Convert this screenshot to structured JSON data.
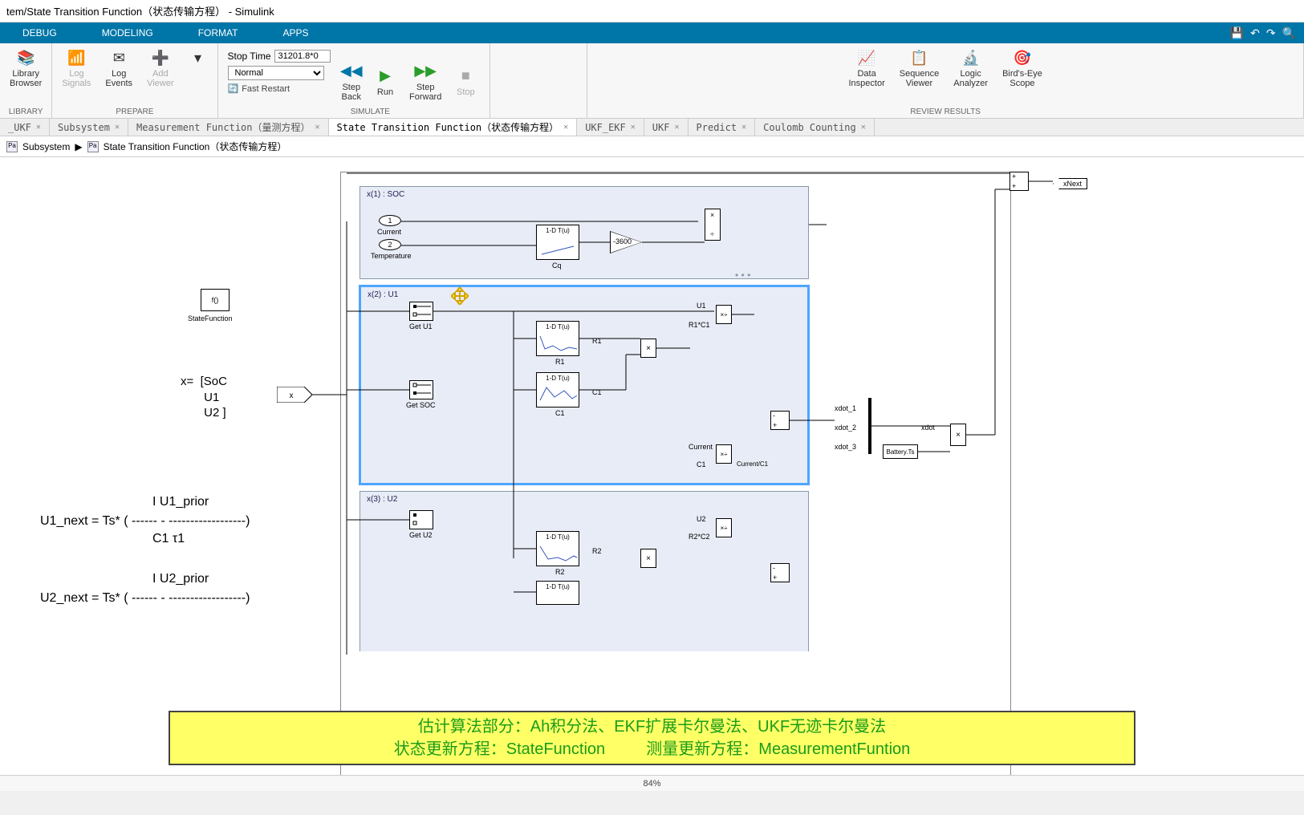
{
  "titlebar": "tem/State Transition Function（状态传输方程） - Simulink",
  "ribbon": {
    "tabs": [
      "DEBUG",
      "MODELING",
      "FORMAT",
      "APPS"
    ],
    "save_icon": "💾",
    "undo_icon": "↶",
    "redo_icon": "↷",
    "search_icon": "🔍"
  },
  "toolstrip": {
    "library": {
      "label": "Library\nBrowser",
      "group": "LIBRARY"
    },
    "prepare": {
      "group": "PREPARE",
      "log_signals": "Log\nSignals",
      "log_events": "Log\nEvents",
      "add_viewer": "Add\nViewer"
    },
    "simulate": {
      "group": "SIMULATE",
      "stop_time_label": "Stop Time",
      "stop_time_value": "31201.8*0",
      "mode": "Normal",
      "fast_restart": "Fast Restart",
      "step_back": "Step\nBack",
      "run": "Run",
      "step_forward": "Step\nForward",
      "stop": "Stop"
    },
    "review": {
      "group": "REVIEW RESULTS",
      "data_inspector": "Data\nInspector",
      "sequence_viewer": "Sequence\nViewer",
      "logic_analyzer": "Logic\nAnalyzer",
      "birds_eye": "Bird's-Eye\nScope"
    }
  },
  "model_tabs": [
    {
      "label": "_UKF",
      "active": false
    },
    {
      "label": "Subsystem",
      "active": false
    },
    {
      "label": "Measurement Function（量测方程）",
      "active": false
    },
    {
      "label": "State Transition Function（状态传输方程）",
      "active": true
    },
    {
      "label": "UKF_EKF",
      "active": false
    },
    {
      "label": "UKF",
      "active": false
    },
    {
      "label": "Predict",
      "active": false
    },
    {
      "label": "Coulomb Counting",
      "active": false
    }
  ],
  "breadcrumb": {
    "items": [
      "Subsystem",
      "State Transition Function（状态传输方程）"
    ]
  },
  "canvas": {
    "state_fn": "f()",
    "state_fn_label": "StateFunction",
    "x_eq": "x=  [SoC\n       U1\n       U2 ]",
    "eq1_top": "I          U1_prior",
    "eq1_mid": "U1_next  =  Ts* ( ------  -  ------------------)",
    "eq1_bot": "C1            τ1",
    "eq2_top": "I          U2_prior",
    "eq2_mid": "U2_next = Ts* ( ------  -  ------------------)",
    "subsys": [
      {
        "title": "x(1) : SOC"
      },
      {
        "title": "x(2) : U1"
      },
      {
        "title": "x(3) : U2"
      }
    ],
    "ports": {
      "current": "Current",
      "temperature": "Temperature",
      "p1": "1",
      "p2": "2"
    },
    "blocks": {
      "lookup": "1-D T(u)",
      "cq": "Cq",
      "gain_val": "-3600",
      "get_u1": "Get U1",
      "get_soc": "Get SOC",
      "get_u2": "Get U2",
      "r1": "R1",
      "c1": "C1",
      "r2": "R2",
      "u1": "U1",
      "u2": "U2",
      "r1c1": "R1*C1",
      "r2c2": "R2*C2",
      "current": "Current",
      "current_c1": "Current/C1",
      "xdot1": "xdot_1",
      "xdot2": "xdot_2",
      "xdot3": "xdot_3",
      "xdot": "xdot",
      "battery_ts": "Battery.Ts",
      "x": "x",
      "xnext": "xNext"
    }
  },
  "overlay": {
    "line1": "估计算法部分：Ah积分法、EKF扩展卡尔曼法、UKF无迹卡尔曼法",
    "line2a": "状态更新方程：StateFunction",
    "line2b": "测量更新方程：MeasurementFuntion"
  },
  "status": {
    "zoom": "84%"
  }
}
